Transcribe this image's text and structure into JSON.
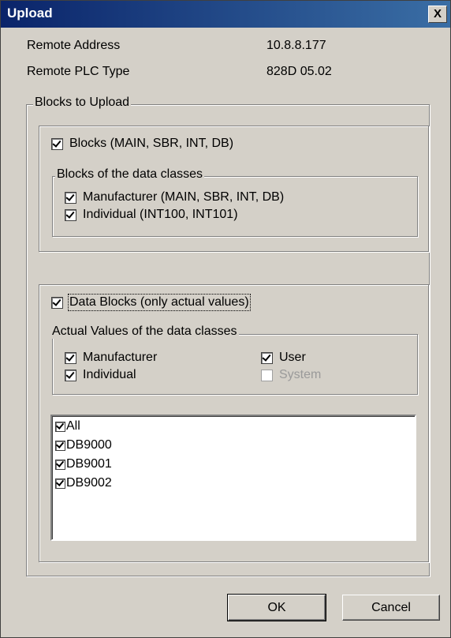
{
  "window": {
    "title": "Upload",
    "close_label": "X"
  },
  "info": {
    "remote_address_label": "Remote Address",
    "remote_address_value": "10.8.8.177",
    "plc_type_label": "Remote PLC Type",
    "plc_type_value": "828D 05.02"
  },
  "blocks_to_upload": {
    "legend": "Blocks to Upload",
    "blocks": {
      "label": "Blocks (MAIN, SBR, INT, DB)",
      "checked": true,
      "classes_legend": "Blocks of the data classes",
      "manufacturer_label": "Manufacturer (MAIN, SBR, INT, DB)",
      "individual_label": "Individual (INT100, INT101)"
    },
    "data_blocks": {
      "label": "Data Blocks (only actual values)",
      "checked": true,
      "classes_legend": "Actual Values of the data classes",
      "manufacturer_label": "Manufacturer",
      "individual_label": "Individual",
      "user_label": "User",
      "system_label": "System"
    },
    "list": [
      {
        "label": "All",
        "checked": true
      },
      {
        "label": "DB9000",
        "checked": true
      },
      {
        "label": "DB9001",
        "checked": true
      },
      {
        "label": "DB9002",
        "checked": true
      }
    ]
  },
  "buttons": {
    "ok": "OK",
    "cancel": "Cancel"
  }
}
